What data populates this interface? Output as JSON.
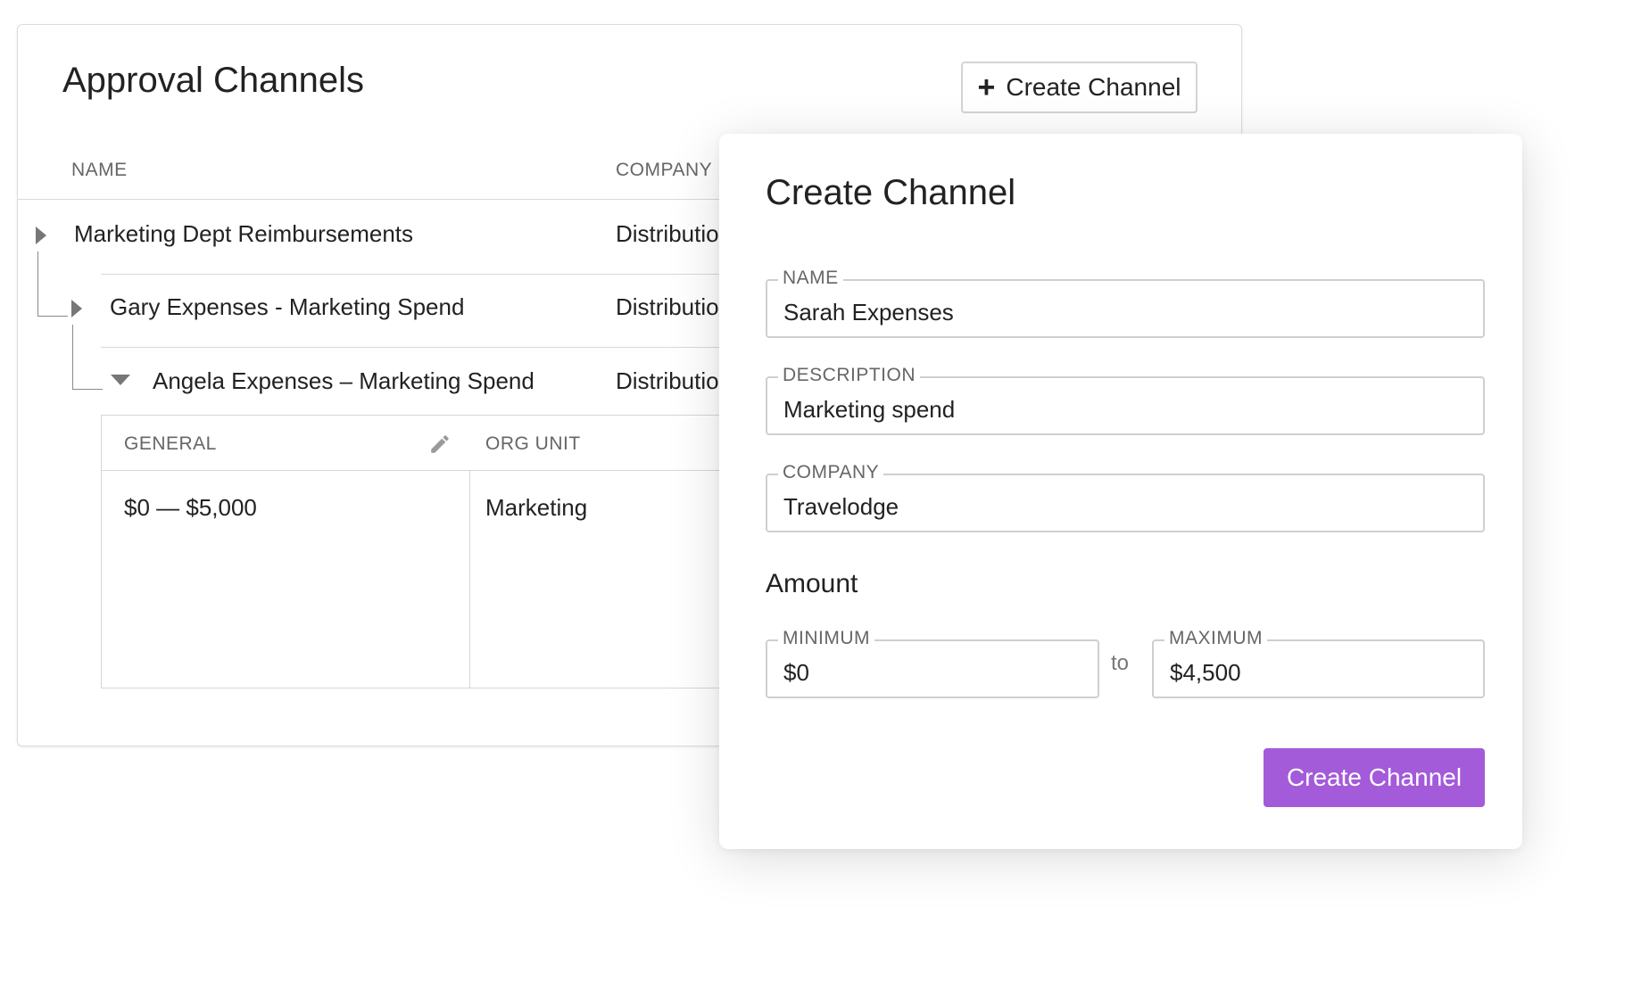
{
  "page": {
    "title": "Approval Channels",
    "create_button_label": "Create Channel",
    "create_button_icon": "plus-icon"
  },
  "table": {
    "columns": [
      "NAME",
      "COMPANY"
    ],
    "rows": [
      {
        "name": "Marketing Dept Reimbursements",
        "company": "Distribution",
        "expanded": false
      },
      {
        "name": "Gary Expenses - Marketing Spend",
        "company": "Distribution",
        "expanded": false
      },
      {
        "name": "Angela Expenses – Marketing Spend",
        "company": "Distribution",
        "expanded": true
      }
    ],
    "expanded_detail": {
      "columns": [
        "GENERAL",
        "ORG UNIT"
      ],
      "general_value": "$0 — $5,000",
      "org_unit_value": "Marketing",
      "edit_icon": "pencil-icon"
    }
  },
  "modal": {
    "title": "Create Channel",
    "fields": {
      "name": {
        "label": "NAME",
        "value": "Sarah Expenses"
      },
      "description": {
        "label": "DESCRIPTION",
        "value": "Marketing spend"
      },
      "company": {
        "label": "COMPANY",
        "value": "Travelodge"
      }
    },
    "amount": {
      "section_label": "Amount",
      "minimum": {
        "label": "MINIMUM",
        "value": "$0"
      },
      "separator": "to",
      "maximum": {
        "label": "MAXIMUM",
        "value": "$4,500"
      }
    },
    "submit_label": "Create Channel",
    "accent_color": "#a35bd9"
  }
}
